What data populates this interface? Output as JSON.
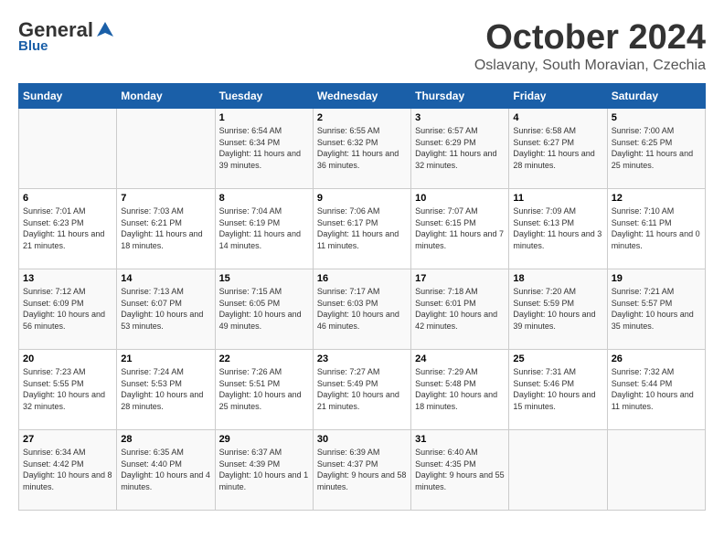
{
  "header": {
    "logo_general": "General",
    "logo_blue": "Blue",
    "month": "October 2024",
    "location": "Oslavany, South Moravian, Czechia"
  },
  "days_of_week": [
    "Sunday",
    "Monday",
    "Tuesday",
    "Wednesday",
    "Thursday",
    "Friday",
    "Saturday"
  ],
  "weeks": [
    [
      {
        "day": "",
        "info": ""
      },
      {
        "day": "",
        "info": ""
      },
      {
        "day": "1",
        "info": "Sunrise: 6:54 AM\nSunset: 6:34 PM\nDaylight: 11 hours and 39 minutes."
      },
      {
        "day": "2",
        "info": "Sunrise: 6:55 AM\nSunset: 6:32 PM\nDaylight: 11 hours and 36 minutes."
      },
      {
        "day": "3",
        "info": "Sunrise: 6:57 AM\nSunset: 6:29 PM\nDaylight: 11 hours and 32 minutes."
      },
      {
        "day": "4",
        "info": "Sunrise: 6:58 AM\nSunset: 6:27 PM\nDaylight: 11 hours and 28 minutes."
      },
      {
        "day": "5",
        "info": "Sunrise: 7:00 AM\nSunset: 6:25 PM\nDaylight: 11 hours and 25 minutes."
      }
    ],
    [
      {
        "day": "6",
        "info": "Sunrise: 7:01 AM\nSunset: 6:23 PM\nDaylight: 11 hours and 21 minutes."
      },
      {
        "day": "7",
        "info": "Sunrise: 7:03 AM\nSunset: 6:21 PM\nDaylight: 11 hours and 18 minutes."
      },
      {
        "day": "8",
        "info": "Sunrise: 7:04 AM\nSunset: 6:19 PM\nDaylight: 11 hours and 14 minutes."
      },
      {
        "day": "9",
        "info": "Sunrise: 7:06 AM\nSunset: 6:17 PM\nDaylight: 11 hours and 11 minutes."
      },
      {
        "day": "10",
        "info": "Sunrise: 7:07 AM\nSunset: 6:15 PM\nDaylight: 11 hours and 7 minutes."
      },
      {
        "day": "11",
        "info": "Sunrise: 7:09 AM\nSunset: 6:13 PM\nDaylight: 11 hours and 3 minutes."
      },
      {
        "day": "12",
        "info": "Sunrise: 7:10 AM\nSunset: 6:11 PM\nDaylight: 11 hours and 0 minutes."
      }
    ],
    [
      {
        "day": "13",
        "info": "Sunrise: 7:12 AM\nSunset: 6:09 PM\nDaylight: 10 hours and 56 minutes."
      },
      {
        "day": "14",
        "info": "Sunrise: 7:13 AM\nSunset: 6:07 PM\nDaylight: 10 hours and 53 minutes."
      },
      {
        "day": "15",
        "info": "Sunrise: 7:15 AM\nSunset: 6:05 PM\nDaylight: 10 hours and 49 minutes."
      },
      {
        "day": "16",
        "info": "Sunrise: 7:17 AM\nSunset: 6:03 PM\nDaylight: 10 hours and 46 minutes."
      },
      {
        "day": "17",
        "info": "Sunrise: 7:18 AM\nSunset: 6:01 PM\nDaylight: 10 hours and 42 minutes."
      },
      {
        "day": "18",
        "info": "Sunrise: 7:20 AM\nSunset: 5:59 PM\nDaylight: 10 hours and 39 minutes."
      },
      {
        "day": "19",
        "info": "Sunrise: 7:21 AM\nSunset: 5:57 PM\nDaylight: 10 hours and 35 minutes."
      }
    ],
    [
      {
        "day": "20",
        "info": "Sunrise: 7:23 AM\nSunset: 5:55 PM\nDaylight: 10 hours and 32 minutes."
      },
      {
        "day": "21",
        "info": "Sunrise: 7:24 AM\nSunset: 5:53 PM\nDaylight: 10 hours and 28 minutes."
      },
      {
        "day": "22",
        "info": "Sunrise: 7:26 AM\nSunset: 5:51 PM\nDaylight: 10 hours and 25 minutes."
      },
      {
        "day": "23",
        "info": "Sunrise: 7:27 AM\nSunset: 5:49 PM\nDaylight: 10 hours and 21 minutes."
      },
      {
        "day": "24",
        "info": "Sunrise: 7:29 AM\nSunset: 5:48 PM\nDaylight: 10 hours and 18 minutes."
      },
      {
        "day": "25",
        "info": "Sunrise: 7:31 AM\nSunset: 5:46 PM\nDaylight: 10 hours and 15 minutes."
      },
      {
        "day": "26",
        "info": "Sunrise: 7:32 AM\nSunset: 5:44 PM\nDaylight: 10 hours and 11 minutes."
      }
    ],
    [
      {
        "day": "27",
        "info": "Sunrise: 6:34 AM\nSunset: 4:42 PM\nDaylight: 10 hours and 8 minutes."
      },
      {
        "day": "28",
        "info": "Sunrise: 6:35 AM\nSunset: 4:40 PM\nDaylight: 10 hours and 4 minutes."
      },
      {
        "day": "29",
        "info": "Sunrise: 6:37 AM\nSunset: 4:39 PM\nDaylight: 10 hours and 1 minute."
      },
      {
        "day": "30",
        "info": "Sunrise: 6:39 AM\nSunset: 4:37 PM\nDaylight: 9 hours and 58 minutes."
      },
      {
        "day": "31",
        "info": "Sunrise: 6:40 AM\nSunset: 4:35 PM\nDaylight: 9 hours and 55 minutes."
      },
      {
        "day": "",
        "info": ""
      },
      {
        "day": "",
        "info": ""
      }
    ]
  ]
}
